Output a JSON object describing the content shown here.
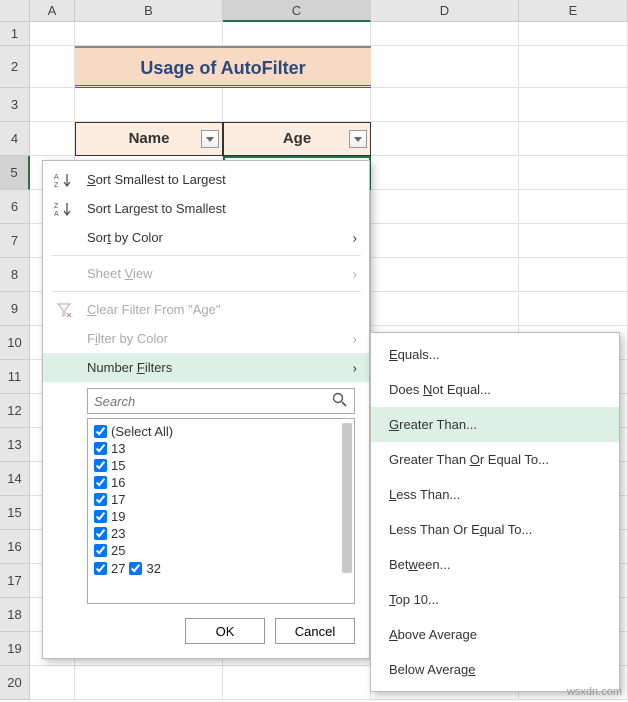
{
  "columns": [
    "A",
    "B",
    "C",
    "D",
    "E"
  ],
  "rows": [
    "1",
    "2",
    "3",
    "4",
    "5",
    "6",
    "7",
    "8",
    "9",
    "10",
    "11",
    "12",
    "13",
    "14",
    "15",
    "16",
    "17",
    "18",
    "19",
    "20"
  ],
  "title": "Usage of AutoFilter",
  "headers": {
    "name": "Name",
    "age": "Age"
  },
  "menu": {
    "sort_asc": {
      "pre": "S",
      "rest": "ort Smallest to Largest"
    },
    "sort_desc": "Sort Largest to Smallest",
    "sort_color": {
      "pre": "Sor",
      "u": "t",
      "post": " by Color"
    },
    "sheet_view": {
      "pre": "Sheet ",
      "u": "V",
      "post": "iew"
    },
    "clear_filter": {
      "pre": "",
      "u": "C",
      "post": "lear Filter From \"Age\""
    },
    "filter_color": {
      "pre": "F",
      "u": "i",
      "post": "lter by Color"
    },
    "number_filters": {
      "pre": "Number ",
      "u": "F",
      "post": "ilters"
    }
  },
  "search": {
    "placeholder": "Search"
  },
  "values": {
    "select_all": "(Select All)",
    "list": [
      "13",
      "15",
      "16",
      "17",
      "19",
      "23",
      "25",
      "27",
      "32"
    ]
  },
  "buttons": {
    "ok": "OK",
    "cancel": "Cancel"
  },
  "submenu": {
    "equals": {
      "u": "E",
      "post": "quals..."
    },
    "not_equal": {
      "pre": "Does ",
      "u": "N",
      "post": "ot Equal..."
    },
    "greater": {
      "u": "G",
      "post": "reater Than..."
    },
    "greater_eq": {
      "pre": "Greater Than ",
      "u": "O",
      "post": "r Equal To..."
    },
    "less": {
      "u": "L",
      "post": "ess Than..."
    },
    "less_eq": {
      "pre": "Less Than Or E",
      "u": "q",
      "post": "ual To..."
    },
    "between": {
      "pre": "Bet",
      "u": "w",
      "post": "een..."
    },
    "top10": {
      "u": "T",
      "post": "op 10..."
    },
    "above_avg": {
      "u": "A",
      "post": "bove Average"
    },
    "below_avg": {
      "pre": "Below Averag",
      "u": "e",
      "post": ""
    }
  },
  "watermark": "wsxdn.com"
}
